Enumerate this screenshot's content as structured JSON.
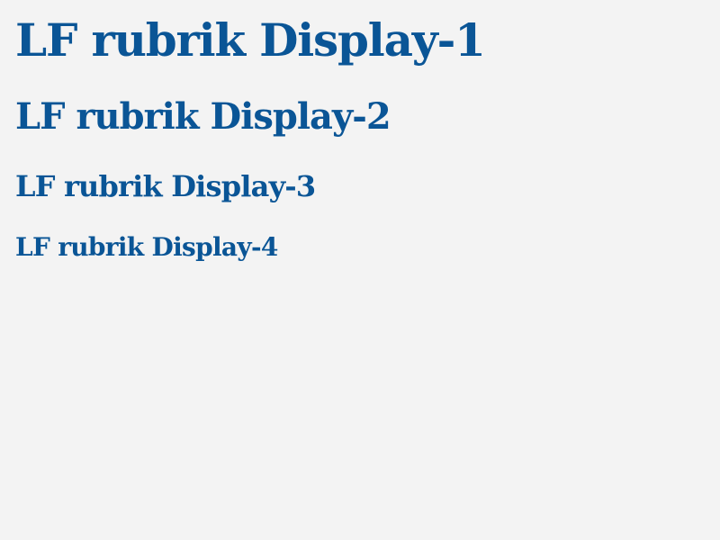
{
  "headings": [
    {
      "text": "LF rubrik Display-1"
    },
    {
      "text": "LF rubrik Display-2"
    },
    {
      "text": "LF rubrik Display-3"
    },
    {
      "text": "LF rubrik Display-4"
    }
  ],
  "colors": {
    "background": "#f3f3f3",
    "heading": "#0a5596"
  }
}
